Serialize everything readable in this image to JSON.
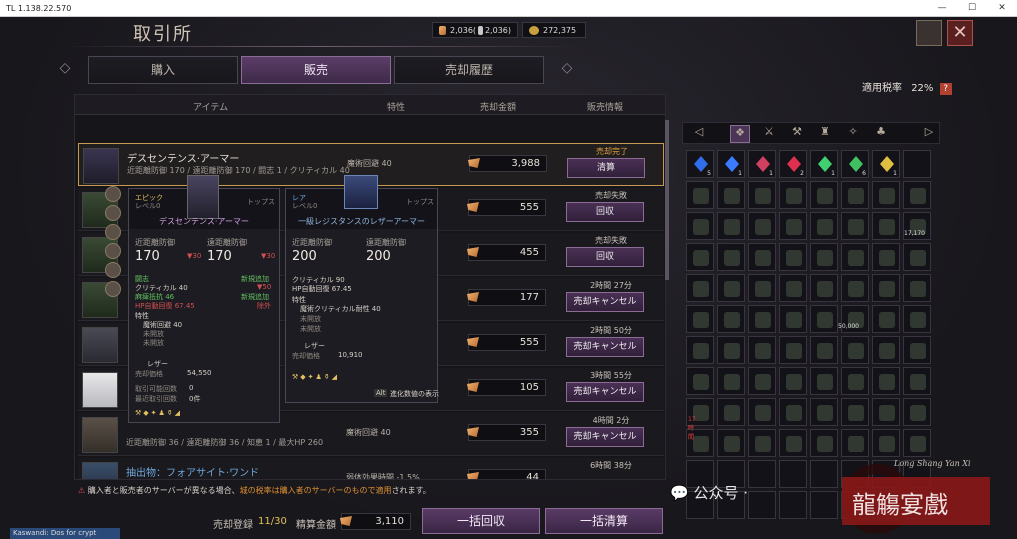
{
  "window": {
    "title": "TL 1.138.22.570"
  },
  "header": {
    "title": "取引所",
    "currency1": "2,036(",
    "currency1b": "2,036)",
    "currency2": "272,375"
  },
  "tabs": [
    {
      "label": "購入"
    },
    {
      "label": "販売"
    },
    {
      "label": "売却履歴"
    }
  ],
  "tax": {
    "label": "適用税率",
    "value": "22%",
    "help": "?"
  },
  "table": {
    "headers": [
      "アイテム",
      "特性",
      "売却金額",
      "販売情報"
    ],
    "rows": [
      {
        "name": "デスセンテンス·アーマー",
        "sub": "近距離防御 170 / 遠距離防御 170 / 闘志 1 / クリティカル 40",
        "trait": "魔術回避 40",
        "price": "3,988",
        "status": "売却完了",
        "button": "清算"
      },
      {
        "name": "",
        "sub": "",
        "trait": "",
        "price": "555",
        "status": "売却失敗",
        "button": "回収"
      },
      {
        "name": "",
        "sub": "",
        "trait": "",
        "price": "455",
        "status": "売却失敗",
        "button": "回収"
      },
      {
        "name": "",
        "sub": "",
        "trait": "",
        "price": "177",
        "status": "2時間 27分",
        "button": "売却キャンセル"
      },
      {
        "name": "",
        "sub": "",
        "trait": "",
        "price": "555",
        "status": "2時間 50分",
        "button": "売却キャンセル"
      },
      {
        "name": "",
        "sub": "",
        "trait": "",
        "price": "105",
        "status": "3時間 55分",
        "button": "売却キャンセル"
      },
      {
        "name": "",
        "sub": "近距離防御 36 / 遠距離防御 36 / 知恵 1 / 最大HP 260",
        "trait": "魔術回避 40",
        "price": "355",
        "status": "4時間 2分",
        "button": "売却キャンセル"
      },
      {
        "name": "抽出物：フォアサイト·ワンド",
        "sub": "",
        "trait": "弱体効果時間 -1.5%",
        "price": "44",
        "status": "6時間 38分",
        "button": ""
      }
    ]
  },
  "tooltip1": {
    "grade": "エピック",
    "level": "レベル0",
    "category": "トップス",
    "name": "デスセンテンス·アーマー",
    "melee_label": "近距離防御",
    "melee": "170",
    "melee_diff": "▼30",
    "ranged_label": "遠距離防御",
    "ranged": "170",
    "ranged_diff": "▼30",
    "l1": "闘志",
    "l1r": "新規追加",
    "l2": "クリティカル 40",
    "l2r": "▼50",
    "l3": "麻痺抵抗 46",
    "l3r": "新規追加",
    "l4": "HP自動回復 67.45",
    "l4r": "除外",
    "trait_label": "特性",
    "trait1": "魔術回避 40",
    "trait2": "未開放",
    "trait3": "未開放",
    "material": "レザー",
    "sell_label": "売却価格",
    "sell": "54,550",
    "trade_label": "取引可能回数",
    "trade": "0",
    "life_label": "最近取引回数",
    "life": "0件"
  },
  "tooltip2": {
    "grade": "レア",
    "level": "レベル0",
    "category": "トップス",
    "name": "一級レジスタンスのレザーアーマー",
    "melee_label": "近距離防御",
    "melee": "200",
    "ranged_label": "遠距離防御",
    "ranged": "200",
    "l1": "クリティカル 90",
    "l2": "HP自動回復 67.45",
    "trait_label": "特性",
    "trait1": "魔術クリティカル耐性 40",
    "trait2": "未開放",
    "trait3": "未開放",
    "material": "レザー",
    "sell_label": "売却価格",
    "sell": "10,910",
    "hint_key": "Alt",
    "hint": "進化数値の表示"
  },
  "footer": {
    "warning_a": "購入者と販売者のサーバーが異なる場合、",
    "warning_b": "城の税率は購入者のサーバーのもので適用",
    "warning_c": "されます。",
    "registered_label": "売却登録",
    "registered": "11/30",
    "settle_label": "精算金額",
    "settle": "3,110",
    "btn_collect_all": "一括回収",
    "btn_settle_all": "一括清算"
  },
  "inventory": {
    "gems": [
      {
        "color": "#2f6ee8",
        "count": "5"
      },
      {
        "color": "#3b7cff",
        "count": "1"
      },
      {
        "color": "#d04060",
        "count": "1"
      },
      {
        "color": "#e03050",
        "count": "2"
      },
      {
        "color": "#40d070",
        "count": "1"
      },
      {
        "color": "#40c060",
        "count": "6"
      },
      {
        "color": "#e0c040",
        "count": "1"
      }
    ],
    "label_170": "17,170",
    "label_50k": "50,000",
    "label_timer": "17時間"
  },
  "taskbar": {
    "label": "Kaswandi: Dos for crypt"
  },
  "watermark": {
    "text": "公众号 ·",
    "signature": "Long Shang Yan Xi",
    "seal": "龍觴宴戲"
  }
}
